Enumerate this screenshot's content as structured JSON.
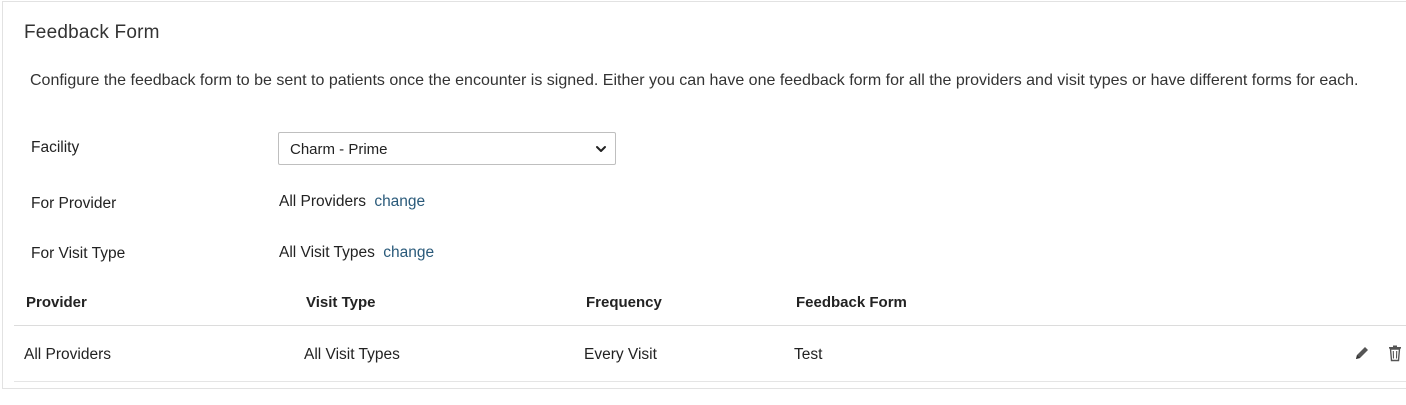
{
  "page": {
    "title": "Feedback Form",
    "description": "Configure the feedback form to be sent to patients once the encounter is signed. Either you can have one feedback form for all the providers and visit types or have different forms for each."
  },
  "form": {
    "facility_label": "Facility",
    "facility_value": "Charm - Prime",
    "provider_label": "For Provider",
    "provider_value": "All Providers",
    "visit_type_label": "For Visit Type",
    "visit_type_value": "All Visit Types",
    "change_label": "change"
  },
  "table": {
    "columns": [
      "Provider",
      "Visit Type",
      "Frequency",
      "Feedback Form"
    ],
    "rows": [
      [
        "All Providers",
        "All Visit Types",
        "Every Visit",
        "Test"
      ]
    ]
  },
  "icons": {
    "edit": "pencil-icon",
    "delete": "trash-icon",
    "dropdown": "chevron-down-icon"
  },
  "colors": {
    "link": "#2a5a7a",
    "border": "#e2e2e2",
    "icon": "#555555"
  }
}
